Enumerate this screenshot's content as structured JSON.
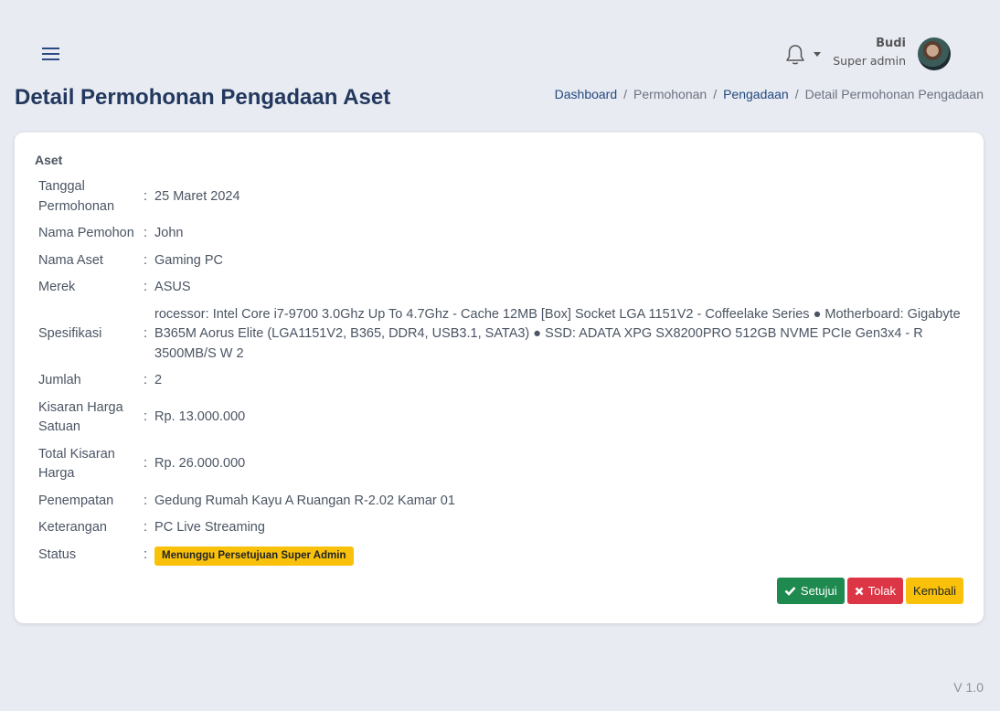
{
  "header": {
    "user_name": "Budi",
    "user_role": "Super admin"
  },
  "page": {
    "title": "Detail Permohonan Pengadaan Aset",
    "breadcrumb": [
      "Dashboard",
      "Permohonan",
      "Pengadaan",
      "Detail Permohonan Pengadaan"
    ]
  },
  "detail": {
    "section_title": "Aset",
    "rows": [
      {
        "label": "Tanggal Permohonan",
        "value": "25 Maret 2024"
      },
      {
        "label": "Nama Pemohon",
        "value": "John"
      },
      {
        "label": "Nama Aset",
        "value": "Gaming PC"
      },
      {
        "label": "Merek",
        "value": "ASUS"
      },
      {
        "label": "Spesifikasi",
        "value": "rocessor: Intel Core i7-9700 3.0Ghz Up To 4.7Ghz - Cache 12MB [Box] Socket LGA 1151V2 - Coffeelake Series ● Motherboard: Gigabyte B365M Aorus Elite (LGA1151V2, B365, DDR4, USB3.1, SATA3) ● SSD: ADATA XPG SX8200PRO 512GB NVME PCIe Gen3x4 - R 3500MB/S W 2"
      },
      {
        "label": "Jumlah",
        "value": "2"
      },
      {
        "label": "Kisaran Harga Satuan",
        "value": "Rp. 13.000.000"
      },
      {
        "label": "Total Kisaran Harga",
        "value": "Rp. 26.000.000"
      },
      {
        "label": "Penempatan",
        "value": "Gedung Rumah Kayu A Ruangan R-2.02 Kamar 01"
      },
      {
        "label": "Keterangan",
        "value": "PC Live Streaming"
      }
    ],
    "status_label": "Status",
    "status_value": "Menunggu Persetujuan Super Admin",
    "colon": ":"
  },
  "actions": {
    "approve": "Setujui",
    "reject": "Tolak",
    "back": "Kembali"
  },
  "footer": {
    "version": "V 1.0"
  },
  "colors": {
    "primary_navy": "#23385f",
    "approve_green": "#1e8a4f",
    "reject_red": "#dc3545",
    "warning_yellow": "#f9c10a"
  },
  "icons": [
    "menu-icon",
    "bell-icon",
    "chevron-down-icon",
    "check-icon",
    "close-icon"
  ]
}
